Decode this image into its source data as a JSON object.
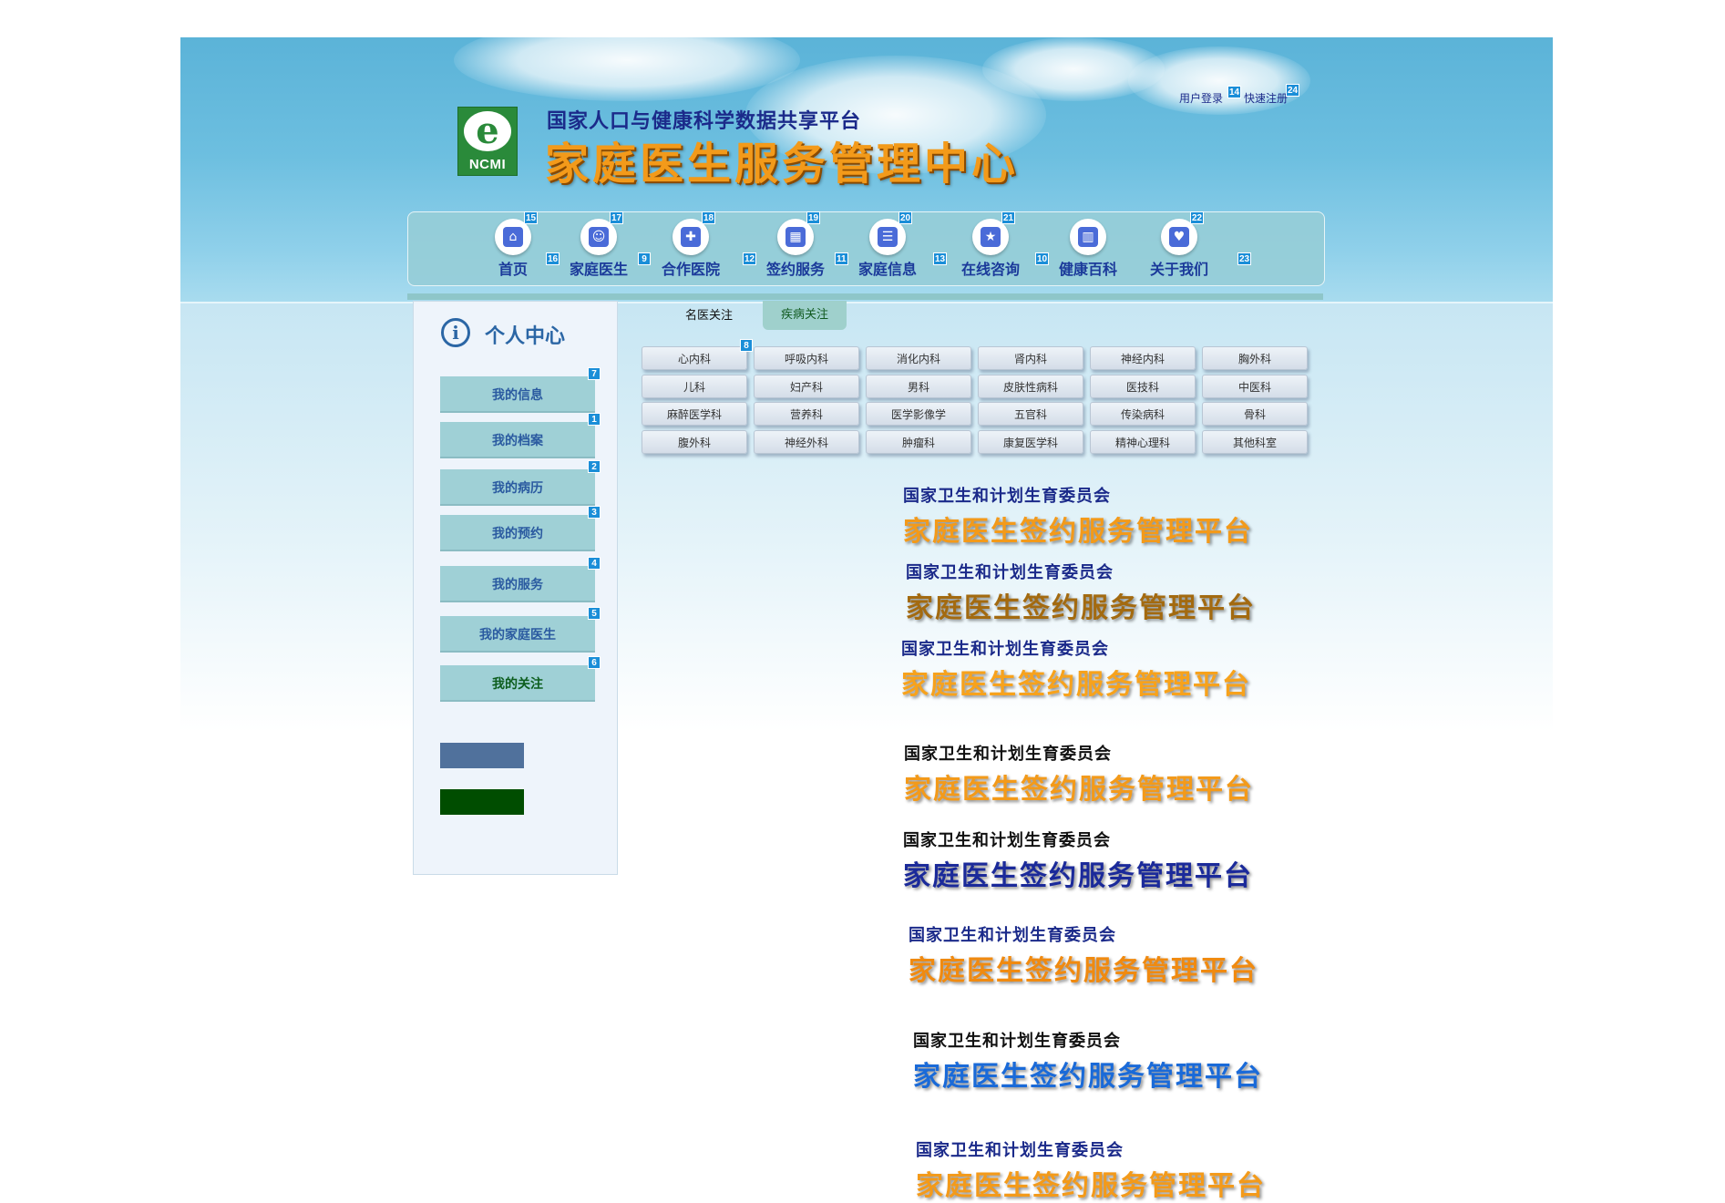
{
  "header": {
    "logo_letter": "e",
    "logo_text": "NCMI",
    "subtitle": "国家人口与健康科学数据共享平台",
    "title": "家庭医生服务管理中心",
    "login": "用户登录",
    "register": "快速注册",
    "badges": {
      "login": "14",
      "register": "24"
    }
  },
  "nav": {
    "items": [
      {
        "label": "首页",
        "badge": "15",
        "pre_badge": "",
        "icon": "home-icon",
        "glyph": "⌂"
      },
      {
        "label": "家庭医生",
        "badge": "17",
        "pre_badge": "16",
        "icon": "doctor-icon",
        "glyph": "☺"
      },
      {
        "label": "合作医院",
        "badge": "18",
        "pre_badge": "9",
        "icon": "hospital-icon",
        "glyph": "✚"
      },
      {
        "label": "签约服务",
        "badge": "19",
        "pre_badge": "12",
        "icon": "calendar-icon",
        "glyph": "▦"
      },
      {
        "label": "家庭信息",
        "badge": "20",
        "pre_badge": "11",
        "icon": "document-icon",
        "glyph": "☰"
      },
      {
        "label": "在线咨询",
        "badge": "21",
        "pre_badge": "13",
        "icon": "star-icon",
        "glyph": "★"
      },
      {
        "label": "健康百科",
        "badge": "",
        "pre_badge": "10",
        "icon": "book-icon",
        "glyph": "▥"
      },
      {
        "label": "关于我们",
        "badge": "22",
        "pre_badge": "",
        "icon": "handshake-icon",
        "glyph": "♥"
      }
    ],
    "trailing_badge": "23"
  },
  "sidebar": {
    "title": "个人中心",
    "items": [
      {
        "label": "我的信息",
        "badge": "7"
      },
      {
        "label": "我的档案",
        "badge": "1"
      },
      {
        "label": "我的病历",
        "badge": "2"
      },
      {
        "label": "我的预约",
        "badge": "3"
      },
      {
        "label": "我的服务",
        "badge": "4"
      },
      {
        "label": "我的家庭医生",
        "badge": "5"
      },
      {
        "label": "我的关注",
        "badge": "6"
      }
    ],
    "swatch_colors": [
      "#50719c",
      "#004d00"
    ]
  },
  "tabs": [
    "名医关注",
    "疾病关注"
  ],
  "departments": [
    [
      "心内科",
      "呼吸内科",
      "消化内科",
      "肾内科",
      "神经内科",
      "胸外科"
    ],
    [
      "儿科",
      "妇产科",
      "男科",
      "皮肤性病科",
      "医技科",
      "中医科"
    ],
    [
      "麻醉医学科",
      "营养科",
      "医学影像学",
      "五官科",
      "传染病科",
      "骨科"
    ],
    [
      "腹外科",
      "神经外科",
      "肿瘤科",
      "康复医学科",
      "精神心理科",
      "其他科室"
    ]
  ],
  "dept_badge": "8",
  "banners": [
    {
      "sub": "国家卫生和计划生育委员会",
      "main": "家庭医生签约服务管理平台",
      "sub_color": "#1b2a8a",
      "main_color": "#f39a1a"
    },
    {
      "sub": "国家卫生和计划生育委员会",
      "main": "家庭医生签约服务管理平台",
      "sub_color": "#1b2a8a",
      "main_color": "#a36a10"
    },
    {
      "sub": "国家卫生和计划生育委员会",
      "main": "家庭医生签约服务管理平台",
      "sub_color": "#1b2a8a",
      "main_color": "#f7a21c"
    },
    {
      "sub": "国家卫生和计划生育委员会",
      "main": "家庭医生签约服务管理平台",
      "sub_color": "#111111",
      "main_color": "#f39a1a"
    },
    {
      "sub": "国家卫生和计划生育委员会",
      "main": "家庭医生签约服务管理平台",
      "sub_color": "#111111",
      "main_color": "#1b2a9a"
    },
    {
      "sub": "国家卫生和计划生育委员会",
      "main": "家庭医生签约服务管理平台",
      "sub_color": "#1b2a8a",
      "main_color": "#f08a10"
    },
    {
      "sub": "国家卫生和计划生育委员会",
      "main": "家庭医生签约服务管理平台",
      "sub_color": "#111111",
      "main_color": "#1a6ad8"
    },
    {
      "sub": "国家卫生和计划生育委员会",
      "main": "家庭医生签约服务管理平台",
      "sub_color": "#1b2a8a",
      "main_color": "#f39a1a"
    }
  ]
}
